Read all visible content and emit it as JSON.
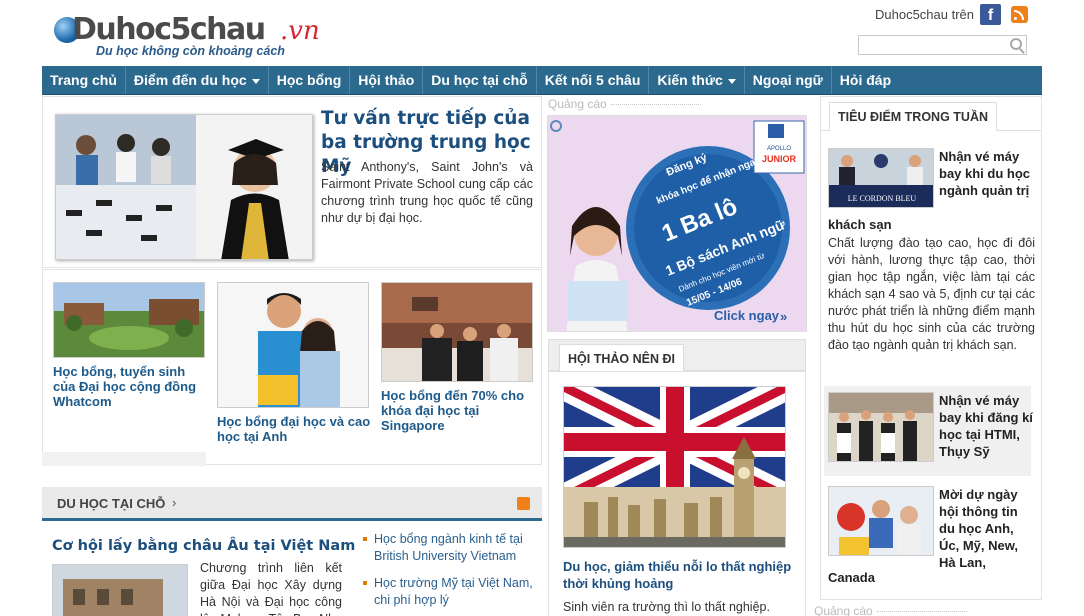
{
  "header": {
    "logo_name": "Duhoc5chau",
    "logo_tld": ".vn",
    "slogan": "Du học không còn khoảng cách",
    "social_label": "Duhoc5chau trên",
    "fb_glyph": "f",
    "search_placeholder": ""
  },
  "nav": {
    "items": [
      {
        "label": "Trang chủ",
        "dropdown": false
      },
      {
        "label": "Điểm đến du học",
        "dropdown": true
      },
      {
        "label": "Học bổng",
        "dropdown": false
      },
      {
        "label": "Hội thảo",
        "dropdown": false
      },
      {
        "label": "Du học tại chỗ",
        "dropdown": false
      },
      {
        "label": "Kết nối 5 châu",
        "dropdown": false
      },
      {
        "label": "Kiến thức",
        "dropdown": true
      },
      {
        "label": "Ngoại ngữ",
        "dropdown": false
      },
      {
        "label": "Hỏi đáp",
        "dropdown": false
      }
    ]
  },
  "featured": {
    "title": "Tư vấn trực tiếp của ba trường trung học Mỹ",
    "description": "Saint Anthony's, Saint John's và Fairmont Private School cung cấp các chương trình trung học quốc tế cũng như dự bị đại học."
  },
  "scholarships": [
    {
      "caption": "Học bổng, tuyển sinh của Đại học cộng đồng Whatcom"
    },
    {
      "caption": "Học bổng đại học và cao học tại Anh"
    },
    {
      "caption": "Học bổng đến 70% cho khóa đại học tại Singapore"
    }
  ],
  "duhoc_section": {
    "title": "DU HỌC TẠI CHỖ",
    "chevron": "›",
    "main_title": "Cơ hội lấy bằng châu Âu tại Việt Nam",
    "main_desc": "Chương trình liên kết giữa Đại học Xây dựng Hà Nội và Đại học công lập Malaga, Tây Ban Nha với...",
    "list": [
      "Học bổng ngành kinh tế tại British University Vietnam",
      "Học trường Mỹ tại Việt Nam, chi phí hợp lý"
    ]
  },
  "middle": {
    "ad_label": "Quảng cáo",
    "ad": {
      "brand_top": "APOLLO",
      "brand_bottom": "JUNIOR",
      "line1": "Đăng ký",
      "line2": "khóa học để nhận ngay",
      "big1": "1 Ba lô",
      "big2": "1 Bộ sách Anh ngữ",
      "small": "Dành cho học viên mới từ",
      "dates": "15/05 - 14/06",
      "cta": "Click ngay"
    },
    "hoithao_tab": "HỘI THẢO NÊN ĐI",
    "ht_title": "Du học, giảm thiểu nỗi lo thất nghiệp thời khủng hoảng",
    "ht_desc": "Sinh viên ra trường thì lo thất nghiệp."
  },
  "right": {
    "tab": "TIÊU ĐIỂM TRONG TUẦN",
    "items": [
      {
        "title": "Nhận vé máy bay khi du học ngành quản trị",
        "title_tail": "khách sạn",
        "img_text": "LE CORDON BLEU"
      },
      {
        "title": "Nhận vé máy bay khi đăng kí học tại HTMI, Thụy Sỹ",
        "title_tail": ""
      },
      {
        "title": "Mời dự ngày hội thông tin du học Anh, Úc, Mỹ, New, Hà Lan,",
        "title_tail": "Canada"
      }
    ],
    "item1_desc": "Chất lượng đào tạo cao, học đi đôi với hành, lương thực tập cao, thời gian học tập ngắn, việc làm tại các khách sạn 4 sao và 5, định cư tại các nước phát triển là những điểm mạnh thu hút du học sinh của các trường đào tạo ngành quản trị khách sạn.",
    "ad_label_bottom": "Quảng cáo"
  },
  "colors": {
    "nav_bg": "#2b6a8e",
    "link": "#1d4f7e",
    "logo_red": "#d7262f",
    "rss": "#f0801a"
  }
}
